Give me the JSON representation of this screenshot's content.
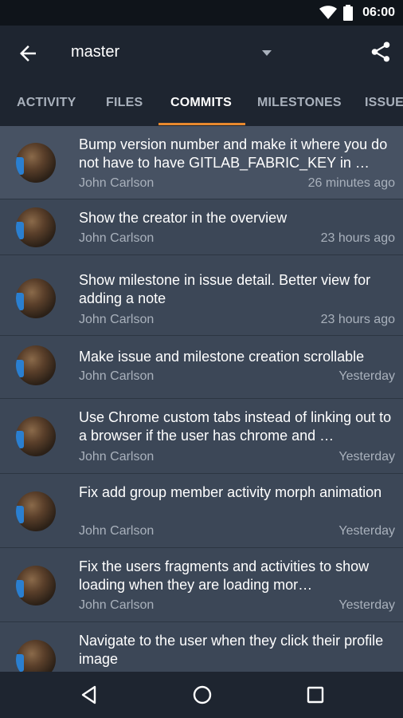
{
  "status": {
    "time": "06:00"
  },
  "appbar": {
    "branch": "master"
  },
  "tabs": [
    {
      "label": "ACTIVITY",
      "active": false
    },
    {
      "label": "FILES",
      "active": false
    },
    {
      "label": "COMMITS",
      "active": true
    },
    {
      "label": "MILESTONES",
      "active": false
    },
    {
      "label": "ISSUES",
      "active": false
    }
  ],
  "commits": [
    {
      "title": "Bump version number and make it where you do not have to have GITLAB_FABRIC_KEY in …",
      "author": "John Carlson",
      "time": "26 minutes ago"
    },
    {
      "title": "Show the creator in the overview",
      "author": "John Carlson",
      "time": "23 hours ago"
    },
    {
      "title": "Show milestone in issue detail. Better view for adding a note",
      "author": "John Carlson",
      "time": "23 hours ago"
    },
    {
      "title": "Make issue and milestone creation scrollable",
      "author": "John Carlson",
      "time": "Yesterday"
    },
    {
      "title": "Use Chrome custom tabs instead of linking out to a browser if the user has chrome and …",
      "author": "John Carlson",
      "time": "Yesterday"
    },
    {
      "title": "Fix add group member activity morph animation",
      "author": "John Carlson",
      "time": "Yesterday"
    },
    {
      "title": "Fix the users fragments and activities to show loading when they are loading mor…",
      "author": "John Carlson",
      "time": "Yesterday"
    },
    {
      "title": "Navigate to the user when they click their profile image",
      "author": "",
      "time": ""
    }
  ],
  "colors": {
    "accent": "#e8892d",
    "appbar": "#1e2530",
    "list_bg": "#3c4757",
    "secondary_text": "#a9b1bc"
  },
  "icons": [
    "wifi-icon",
    "battery-icon",
    "back-arrow-icon",
    "dropdown-icon",
    "share-icon",
    "nav-back-icon",
    "nav-home-icon",
    "nav-recents-icon"
  ]
}
